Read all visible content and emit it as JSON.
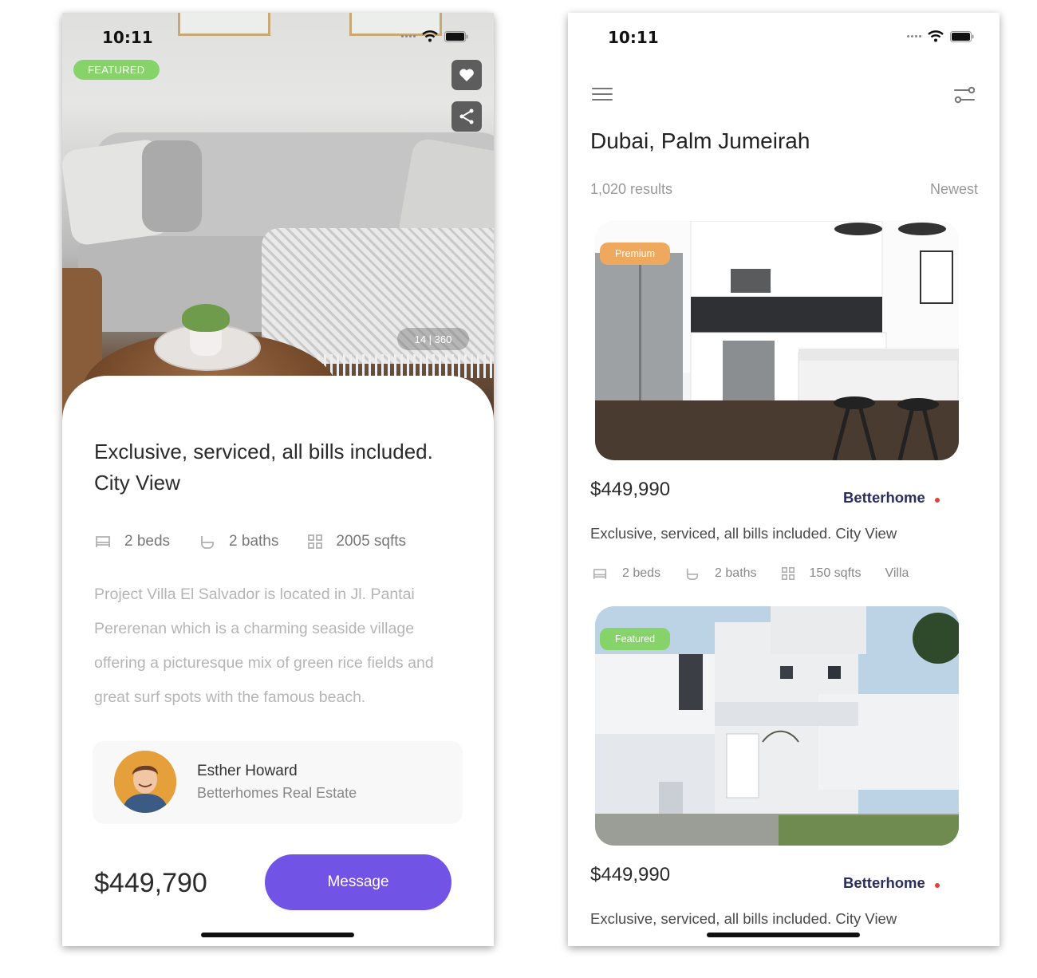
{
  "colors": {
    "accent_purple": "#7153e6",
    "featured_green": "#86d36a",
    "premium_orange": "#efa95f",
    "agency_navy": "#2b2e5c",
    "agency_dot_red": "#e0423a"
  },
  "detail_screen": {
    "status_time": "10:11",
    "hero_badge": "FEATURED",
    "photo_counter": "14 | 360",
    "title": "Exclusive, serviced, all bills included. City View",
    "features": [
      {
        "icon": "bed-icon",
        "label": "2 beds"
      },
      {
        "icon": "bath-icon",
        "label": "2 baths"
      },
      {
        "icon": "area-icon",
        "label": "2005 sqfts"
      }
    ],
    "description": "Project Villa El Salvador is located in Jl. Pantai Pererenan which is a charming seaside village offering a picturesque mix of green rice fields and great surf spots with the famous beach.",
    "agent": {
      "name": "Esther Howard",
      "company": "Betterhomes Real Estate"
    },
    "price": "$449,790",
    "message_button": "Message"
  },
  "list_screen": {
    "status_time": "10:11",
    "location": "Dubai, Palm Jumeirah",
    "results": "1,020 results",
    "sort": "Newest",
    "listings": [
      {
        "badge": "Premium",
        "price": "$449,990",
        "agency": "Betterhome",
        "title": "Exclusive, serviced, all bills included. City View",
        "beds": "2 beds",
        "baths": "2 baths",
        "area": "150 sqfts",
        "type": "Villa"
      },
      {
        "badge": "Featured",
        "price": "$449,990",
        "agency": "Betterhome",
        "title": "Exclusive, serviced, all bills included. City View"
      }
    ]
  }
}
